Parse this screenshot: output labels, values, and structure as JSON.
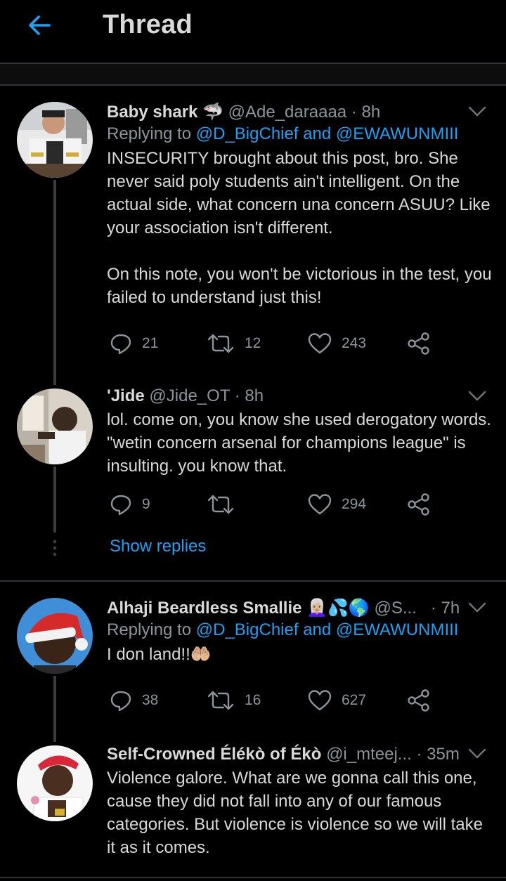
{
  "header": {
    "title": "Thread"
  },
  "tweets": [
    {
      "name": "Baby shark",
      "name_emoji": "🦈",
      "handle": "@Ade_daraaaa",
      "time": "8h",
      "reply_prefix": "Replying to",
      "reply_user1": "@D_BigChief",
      "reply_and": "and",
      "reply_user2": "@EWAWUNMIII",
      "text": "INSECURITY brought about this post, bro. She never said poly students ain't intelligent. On the actual side, what concern una concern ASUU? Like your association isn't different.\n\nOn this note, you won't be victorious in the test, you failed to understand just this!",
      "replies": "21",
      "retweets": "12",
      "likes": "243"
    },
    {
      "name": "'Jide",
      "handle": "@Jide_OT",
      "time": "8h",
      "text": "lol. come on, you know she used derogatory words. \"wetin concern arsenal for champions league\" is insulting. you know that.",
      "replies": "9",
      "retweets": "",
      "likes": "294"
    },
    {
      "name": "Alhaji Beardless Smallie",
      "name_emoji": "👩🏼‍🦳💦🌎",
      "handle": "@S...",
      "time": "7h",
      "reply_prefix": "Replying to",
      "reply_user1": "@D_BigChief",
      "reply_and": "and",
      "reply_user2": "@EWAWUNMIII",
      "text": "I don land!!🤲🏼",
      "replies": "38",
      "retweets": "16",
      "likes": "627"
    },
    {
      "name": "Self-Crowned Élékò of Ékò",
      "handle": "@i_mteej...",
      "time": "35m",
      "text": "Violence galore. What are we gonna call this one, cause they did not fall into any of our famous categories. But violence is violence so we will take it as it comes."
    }
  ],
  "show_replies": "Show replies",
  "colors": {
    "accent": "#1da1f2",
    "background": "#000000",
    "muted": "#8b949a",
    "text": "#d9d9d9"
  },
  "icons": [
    "back-arrow-icon",
    "chevron-down-icon",
    "reply-icon",
    "retweet-icon",
    "like-icon",
    "share-icon"
  ]
}
